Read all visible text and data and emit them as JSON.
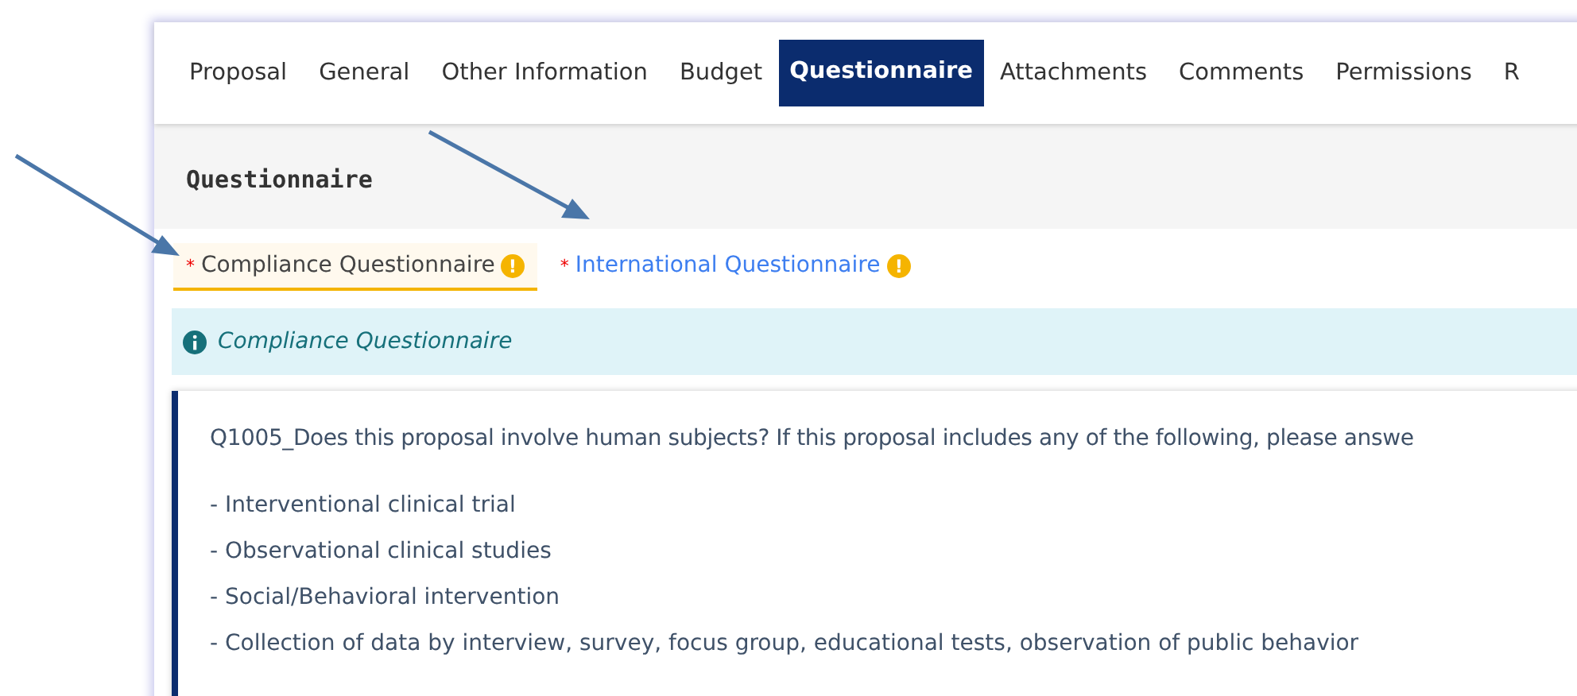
{
  "nav_tabs": [
    {
      "label": "Proposal",
      "selected": false
    },
    {
      "label": "General",
      "selected": false
    },
    {
      "label": "Other Information",
      "selected": false
    },
    {
      "label": "Budget",
      "selected": false
    },
    {
      "label": "Questionnaire",
      "selected": true
    },
    {
      "label": "Attachments",
      "selected": false
    },
    {
      "label": "Comments",
      "selected": false
    },
    {
      "label": "Permissions",
      "selected": false
    },
    {
      "label": "R",
      "selected": false
    }
  ],
  "section_title": "Questionnaire",
  "questionnaire_tabs": [
    {
      "required": "*",
      "label": "Compliance Questionnaire",
      "selected": true,
      "warning": "!"
    },
    {
      "required": "*",
      "label": "International Questionnaire",
      "selected": false,
      "warning": "!"
    }
  ],
  "info_banner": {
    "text": "Compliance Questionnaire"
  },
  "question": {
    "text": "Q1005_Does this proposal involve human subjects? If this proposal includes any of the following, please answe",
    "items": [
      "- Interventional clinical trial",
      "- Observational clinical studies",
      "- Social/Behavioral intervention",
      "- Collection of data by interview, survey, focus group, educational tests, observation of public behavior"
    ]
  }
}
